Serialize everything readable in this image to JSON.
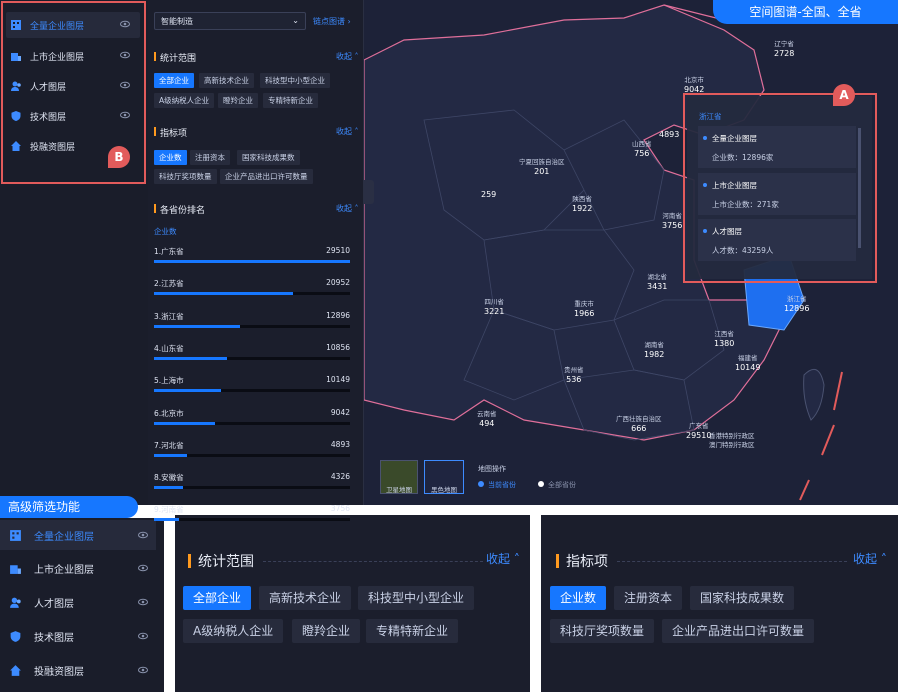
{
  "callouts": {
    "top_right": "空间图谱-全国、全省",
    "bottom_left": "高级筛选功能",
    "badge_a": "A",
    "badge_b": "B"
  },
  "layers": [
    {
      "label": "全量企业图层",
      "icon": "building-icon",
      "active": true
    },
    {
      "label": "上市企业图层",
      "icon": "listed-company-icon",
      "active": false
    },
    {
      "label": "人才图层",
      "icon": "people-icon",
      "active": false
    },
    {
      "label": "技术图层",
      "icon": "shield-icon",
      "active": false
    },
    {
      "label": "投融资图层",
      "icon": "home-icon",
      "active": false
    }
  ],
  "filter": {
    "industry_select": "智能制造",
    "industry_link": "链点图谱",
    "collapse_label": "收起",
    "stat_scope": {
      "title": "统计范围",
      "chips": [
        "全部企业",
        "高新技术企业",
        "科技型中小型企业",
        "A级纳税人企业",
        "瞪羚企业",
        "专精特新企业"
      ]
    },
    "indicators": {
      "title": "指标项",
      "chips": [
        "企业数",
        "注册资本",
        "国家科技成果数",
        "科技厅奖项数量",
        "企业产品进出口许可数量"
      ]
    },
    "ranking": {
      "title": "各省份排名",
      "subtitle": "企业数",
      "rows": [
        {
          "label": "1.广东省",
          "value": "29510",
          "pct": 1.0
        },
        {
          "label": "2.江苏省",
          "value": "20952",
          "pct": 0.71
        },
        {
          "label": "3.浙江省",
          "value": "12896",
          "pct": 0.44
        },
        {
          "label": "4.山东省",
          "value": "10856",
          "pct": 0.37
        },
        {
          "label": "5.上海市",
          "value": "10149",
          "pct": 0.34
        },
        {
          "label": "6.北京市",
          "value": "9042",
          "pct": 0.31
        },
        {
          "label": "7.河北省",
          "value": "4893",
          "pct": 0.17
        },
        {
          "label": "8.安徽省",
          "value": "4326",
          "pct": 0.15
        },
        {
          "label": "9.河南省",
          "value": "3756",
          "pct": 0.13
        }
      ]
    }
  },
  "map": {
    "provinces": [
      {
        "name": "辽宁省",
        "value": "2728"
      },
      {
        "name": "北京市",
        "value": "9042"
      },
      {
        "name": "",
        "value": "4893"
      },
      {
        "name": "山西省",
        "value": "756"
      },
      {
        "name": "宁夏回族自治区",
        "value": "201"
      },
      {
        "name": "陕西省",
        "value": "1922"
      },
      {
        "name": "",
        "value": "259"
      },
      {
        "name": "河南省",
        "value": "3756"
      },
      {
        "name": "湖北省",
        "value": "3431"
      },
      {
        "name": "四川省",
        "value": "3221"
      },
      {
        "name": "重庆市",
        "value": "1966"
      },
      {
        "name": "湖南省",
        "value": "1982"
      },
      {
        "name": "江西省",
        "value": "1380"
      },
      {
        "name": "福建省",
        "value": "10149"
      },
      {
        "name": "贵州省",
        "value": "536"
      },
      {
        "name": "云南省",
        "value": "494"
      },
      {
        "name": "广西壮族自治区",
        "value": "666"
      },
      {
        "name": "广东省",
        "value": "29510"
      },
      {
        "name": "香港特别行政区",
        "value": ""
      },
      {
        "name": "澳门特别行政区",
        "value": ""
      },
      {
        "name": "浙江省",
        "value": "12896"
      }
    ],
    "popup": {
      "title": "浙江省",
      "items": [
        {
          "title": "全量企业图层",
          "value": "企业数：12896家"
        },
        {
          "title": "上市企业图层",
          "value": "上市企业数：271家"
        },
        {
          "title": "人才图层",
          "value": "人才数：43259人"
        }
      ]
    },
    "base_maps": [
      "卫星地图",
      "黑色地图"
    ],
    "ops_title": "地图操作",
    "ops_options": [
      "当前省份",
      "全部省份"
    ]
  }
}
